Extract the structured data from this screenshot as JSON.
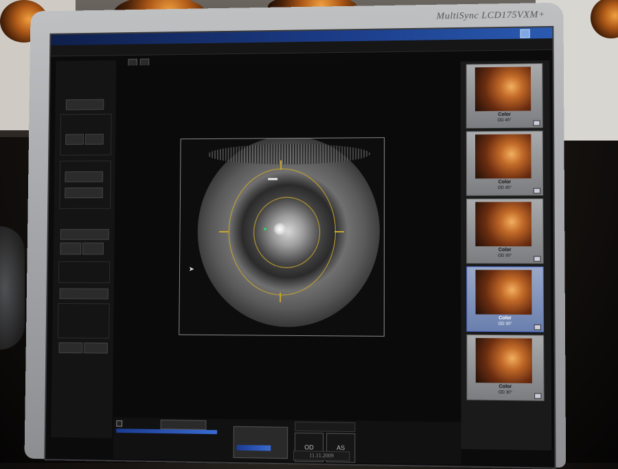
{
  "monitor": {
    "brand": "MultiSync LCD175VXM+"
  },
  "window": {
    "title": ""
  },
  "main": {
    "bottom": {
      "checkbox_label": "",
      "progress_caption": "",
      "left_eye_label": "OD",
      "right_eye_label": "AS",
      "date": "11.11.2009",
      "footer_text": ""
    }
  },
  "thumbnails": [
    {
      "label": "Color",
      "sub": "OD 45°",
      "selected": false
    },
    {
      "label": "Color",
      "sub": "OD 45°",
      "selected": false
    },
    {
      "label": "Color",
      "sub": "OD 30°",
      "selected": false
    },
    {
      "label": "Color",
      "sub": "OD 30°",
      "selected": true
    },
    {
      "label": "Color",
      "sub": "OD 30°",
      "selected": false
    }
  ],
  "colors": {
    "accent": "#1c3d8a",
    "reticle": "#c9a82a",
    "fixation": "#2fd06a"
  },
  "icons": [
    "window-icon",
    "cursor-icon",
    "reticle-icon"
  ]
}
